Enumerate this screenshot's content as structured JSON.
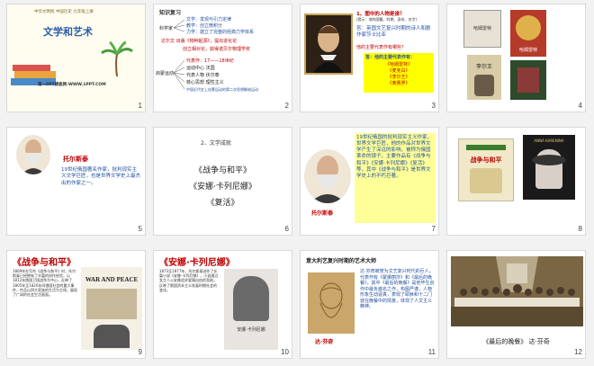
{
  "slides": [
    {
      "num": "1",
      "header_line": "中华文明统 中国历史 九年级上册",
      "title": "文学和艺术",
      "footer": "第一PPT模板网-WWW.1PPT.COM"
    },
    {
      "num": "2",
      "title": "知识复习",
      "rows": [
        "文学：发现与引力定律",
        "教学：创立微积分",
        "力学：建立了完整的经典力学体系",
        "达尔文 出版《物种起源》，提出进化论",
        "创立相对论，获得诺贝尔物理学奖",
        "代表作：17——18世纪",
        "运动中心 法国",
        "代表人物 伏尔泰",
        "核心思想 理性主义",
        "中国近代史上启蒙运动的第二次思想解放运动"
      ],
      "labels": [
        "科学家",
        "启蒙运动"
      ]
    },
    {
      "num": "3",
      "q1": "1、图中的人物是谁？",
      "q1_sub": "(提示：他的国籍、时期、身份、名字)",
      "a1": "答：英国文艺复兴时期的诗人和剧作家莎士比亚",
      "q2": "他的主要代表作有哪些？",
      "a2": "答：他的主要代表作有：",
      "works": [
        "《哈姆雷特》",
        "《麦克白》",
        "《李尔王》",
        "《奥赛罗》"
      ]
    },
    {
      "num": "4",
      "book1": "哈姆雷特",
      "book2": "哈姆雷特",
      "book3": "李尔王"
    },
    {
      "num": "5",
      "name": "托尔斯泰",
      "text": "19世纪俄国著名作家，批判现实主义文学巨匠，也是世界文学史上最杰出的作家之一。"
    },
    {
      "num": "6",
      "heading": "2、文学成就",
      "works": [
        "《战争与和平》",
        "《安娜·卡列尼娜》",
        "《复活》"
      ]
    },
    {
      "num": "7",
      "text": "19世纪俄国的批判现实主义作家，世界文学巨匠，他的作品对世界文学产生了深远的影响，被称为俄国革命的镜子。主要作品有《战争与和平》《安娜·卡列尼娜》《复活》等，其中《战争与和平》是世界文学史上的不朽巨著。",
      "name": "托尔斯泰"
    },
    {
      "num": "8",
      "book1": "战争与和平",
      "book2": "ANNA KARENINA"
    },
    {
      "num": "9",
      "title": "《战争与和平》",
      "text": "1869年在写作《战争与和平》时，托尔斯泰已经拥有了丰富的创作经验，以1812年俄国卫国战争为中心，反映了1805年至1820年间俄国社会的重大事件，作品以四大家族的生活为主线，展现了广阔的社会生活画面。",
      "poster": "WAR AND PEACE"
    },
    {
      "num": "10",
      "title": "《安娜·卡列尼娜》",
      "text": "1873至1877年，托尔斯泰创作了长篇小说《安娜·卡列尼娜》，小说通过女主人公安娜追求爱情自由的悲剧，反映了俄国资本主义发展时期社会的变化。",
      "book": "安娜·卡列尼娜"
    },
    {
      "num": "11",
      "heading": "意大利艺复兴时期的艺术大师",
      "text": "达·芬奇被誉为文艺复兴时代的巨人，代表作有《蒙娜丽莎》和《最后的晚餐》，其中《最后的晚餐》是他毕生创作中最负盛名之作，构图严谨，人物形象生动逼真，表现了耶稣和十二门徒在晚餐中的情景，体现了人文主义精神。",
      "caption": "达·芬奇"
    },
    {
      "num": "12",
      "caption": "《最后的晚餐》 达·芬奇"
    }
  ],
  "colors": {
    "accent_red": "#c00000",
    "accent_blue": "#1f4e9c",
    "green_frame": "#3a7d2c",
    "yellow": "#ffff00"
  }
}
